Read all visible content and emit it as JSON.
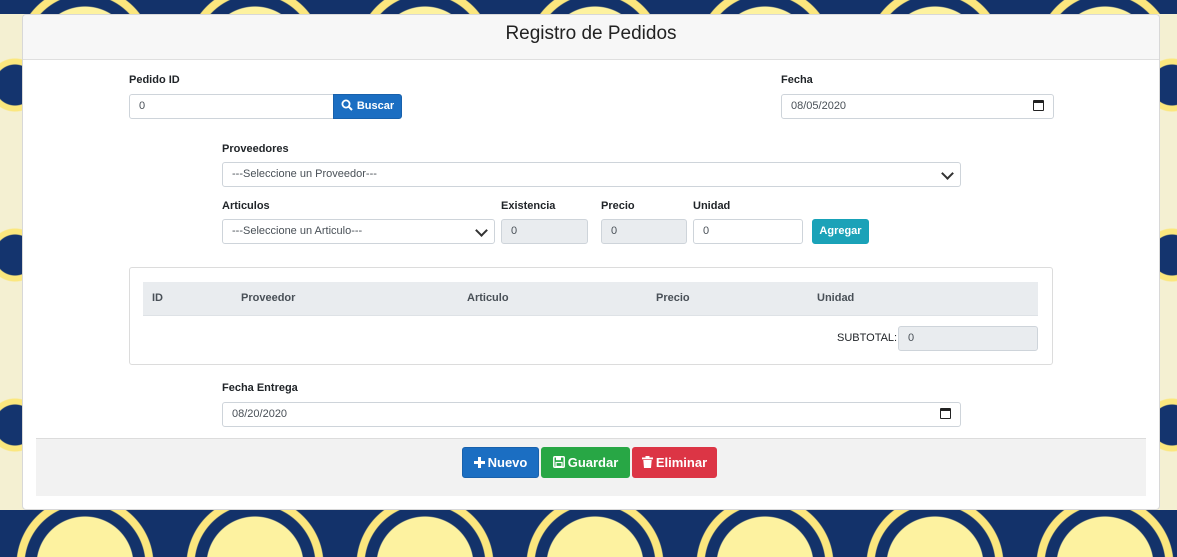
{
  "header": {
    "title": "Registro de Pedidos"
  },
  "pedido": {
    "label": "Pedido ID",
    "value": "0",
    "buscar_label": "Buscar"
  },
  "fecha": {
    "label": "Fecha",
    "value": "08/05/2020"
  },
  "proveedores": {
    "label": "Proveedores",
    "selected": "---Seleccione un Proveedor---"
  },
  "articulos": {
    "label": "Articulos",
    "selected": "---Seleccione un Articulo---"
  },
  "existencia": {
    "label": "Existencia",
    "value": "0"
  },
  "precio": {
    "label": "Precio",
    "value": "0"
  },
  "unidad": {
    "label": "Unidad",
    "value": "0"
  },
  "agregar_label": "Agregar",
  "table": {
    "columns": [
      "ID",
      "Proveedor",
      "Articulo",
      "Precio",
      "Unidad"
    ],
    "subtotal_label": "SUBTOTAL:",
    "subtotal_value": "0"
  },
  "fecha_entrega": {
    "label": "Fecha Entrega",
    "value": "08/20/2020"
  },
  "actions": {
    "nuevo": "Nuevo",
    "guardar": "Guardar",
    "eliminar": "Eliminar"
  },
  "colors": {
    "primary": "#1b6ec2",
    "info": "#1ba2b8",
    "success": "#28a745",
    "danger": "#dc3545",
    "background_navy": "#13326a",
    "background_yellow": "#fdf3a8"
  }
}
